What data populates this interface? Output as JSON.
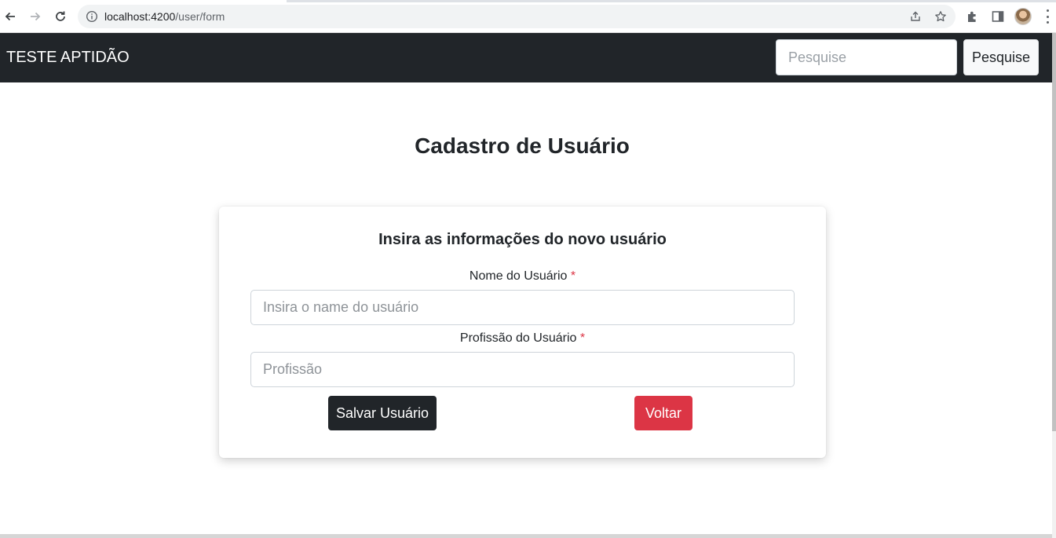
{
  "browser": {
    "url_host": "localhost:4200",
    "url_path": "/user/form",
    "icons": {
      "back": "arrow-left-icon",
      "forward": "arrow-right-icon",
      "reload": "reload-icon",
      "site_info": "info-icon",
      "share": "share-icon",
      "bookmark": "star-icon",
      "extensions": "puzzle-icon",
      "side_panel": "side-panel-icon",
      "menu": "kebab-menu-icon"
    }
  },
  "navbar": {
    "brand": "TESTE APTIDÃO",
    "search_placeholder": "Pesquise",
    "search_button": "Pesquise"
  },
  "main": {
    "title": "Cadastro de Usuário",
    "card": {
      "title": "Insira as informações do novo usuário",
      "fields": [
        {
          "label": "Nome do Usuário",
          "required_mark": "*",
          "placeholder": "Insira o name do usuário",
          "value": ""
        },
        {
          "label": "Profissão do Usuário",
          "required_mark": "*",
          "placeholder": "Profissão",
          "value": ""
        }
      ],
      "save_button": "Salvar Usuário",
      "back_button": "Voltar"
    }
  },
  "colors": {
    "navbar_bg": "#212529",
    "save_button_bg": "#212529",
    "back_button_bg": "#dc3545",
    "required_mark": "#dc3545"
  }
}
